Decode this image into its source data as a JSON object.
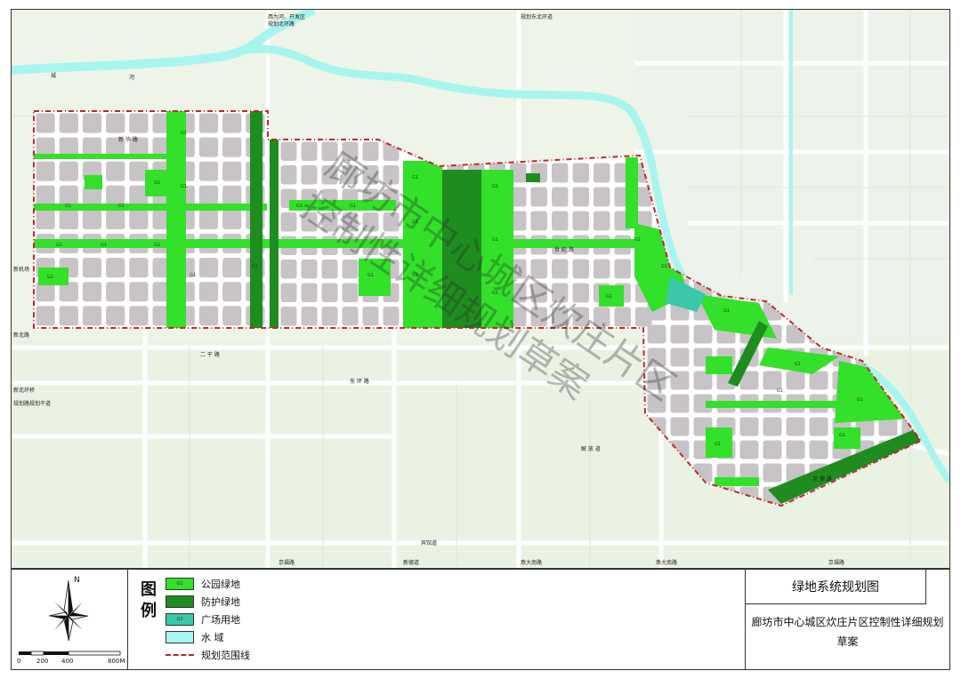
{
  "map": {
    "watermark_line1": "廊坊市中心城区炊庄片区",
    "watermark_line2": "控制性详细规划草案",
    "top_labels": [
      "西为河、开发区",
      "规划北环路",
      "规划东北环道"
    ],
    "left_labels": [
      "新机场",
      "新北路",
      "新北环桥",
      "规划路规划干道"
    ],
    "bottom_labels": [
      "京福路",
      "新德道",
      "燕大南路",
      "燕大南路",
      "京福路"
    ],
    "road_labels": [
      "二 干 路",
      "东 环 路",
      "解 放 道",
      "新 华 路",
      "世 纪 路",
      "京 德 路"
    ],
    "mid_bottom_label": "宾馆道",
    "river_labels": [
      "城",
      "河"
    ],
    "zone_code": "G1",
    "colors": {
      "park": "#33e02a",
      "protective": "#1f8c1f",
      "plaza": "#3ac9a8",
      "water": "#a8f5f0",
      "boundary": "#c1272d",
      "block": "#c8c3c6",
      "road": "#ffffff",
      "background": "#eef5e8"
    }
  },
  "legend": {
    "heading_1": "图",
    "heading_2": "例",
    "items": [
      {
        "code": "G1",
        "label": "公园绿地"
      },
      {
        "code": "",
        "label": "防护绿地"
      },
      {
        "code": "G3",
        "label": "广场用地"
      },
      {
        "code": "",
        "label": "水 域"
      },
      {
        "code": "",
        "label": "规划范围线"
      }
    ]
  },
  "north": {
    "n_label": "N",
    "scale_labels": [
      "0",
      "200",
      "400",
      "800M"
    ]
  },
  "title_block": {
    "title": "绿地系统规划图",
    "subtitle_line1": "廊坊市中心城区炊庄片区控制性详细规划",
    "subtitle_line2": "草案"
  }
}
